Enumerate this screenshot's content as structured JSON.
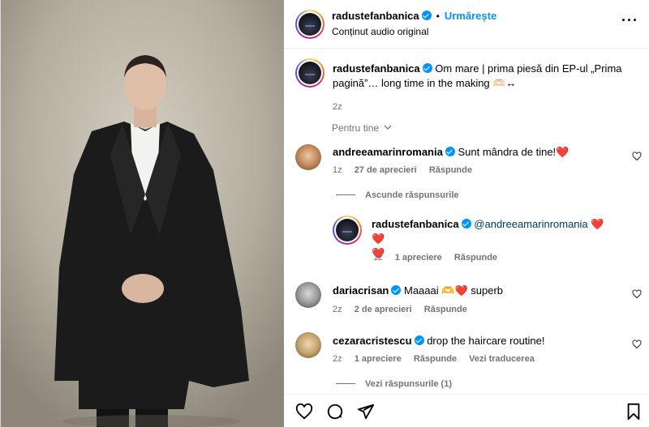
{
  "post": {
    "username": "radustefanbanica",
    "follow_label": "Urmărește",
    "audio_label": "Conținut audio original",
    "more_label": "···",
    "caption": "Om mare | prima piesă din EP-ul „Prima pagină”… long time in the making",
    "caption_emoji": "🫶🏻↔",
    "time": "2z"
  },
  "filter_label": "Pentru tine",
  "comments": [
    {
      "username": "andreeamarinromania",
      "text": "Sunt mândra de tine!",
      "heart": "❤️",
      "time": "1z",
      "likes": "27 de aprecieri",
      "reply": "Răspunde"
    },
    {
      "hide_replies": "Ascunde răspunsurile"
    },
    {
      "username": "radustefanbanica",
      "mention": "@andreeamarinromania",
      "hearts_line1": "❤️ ❤️",
      "hearts_line2": "❤️",
      "time": "1z",
      "likes": "1 apreciere",
      "reply": "Răspunde"
    },
    {
      "username": "dariacrisan",
      "text_before": "Maaaai",
      "text_emoji": "🫶❤️",
      "text_after": "superb",
      "time": "2z",
      "likes": "2 de aprecieri",
      "reply": "Răspunde"
    },
    {
      "username": "cezaracristescu",
      "text": "drop the haircare routine!",
      "time": "2z",
      "likes": "1 apreciere",
      "reply": "Răspunde",
      "translate": "Vezi traducerea"
    },
    {
      "view_replies": "Vezi răspunsurile (1)"
    }
  ],
  "icons": [
    "heart-icon",
    "comment-icon",
    "share-icon",
    "bookmark-icon",
    "verified-icon",
    "chevron-down-icon",
    "more-icon"
  ],
  "colors": {
    "link": "#0095f6",
    "muted": "#737373",
    "heart": "#e0245e",
    "mention": "#00376b"
  }
}
